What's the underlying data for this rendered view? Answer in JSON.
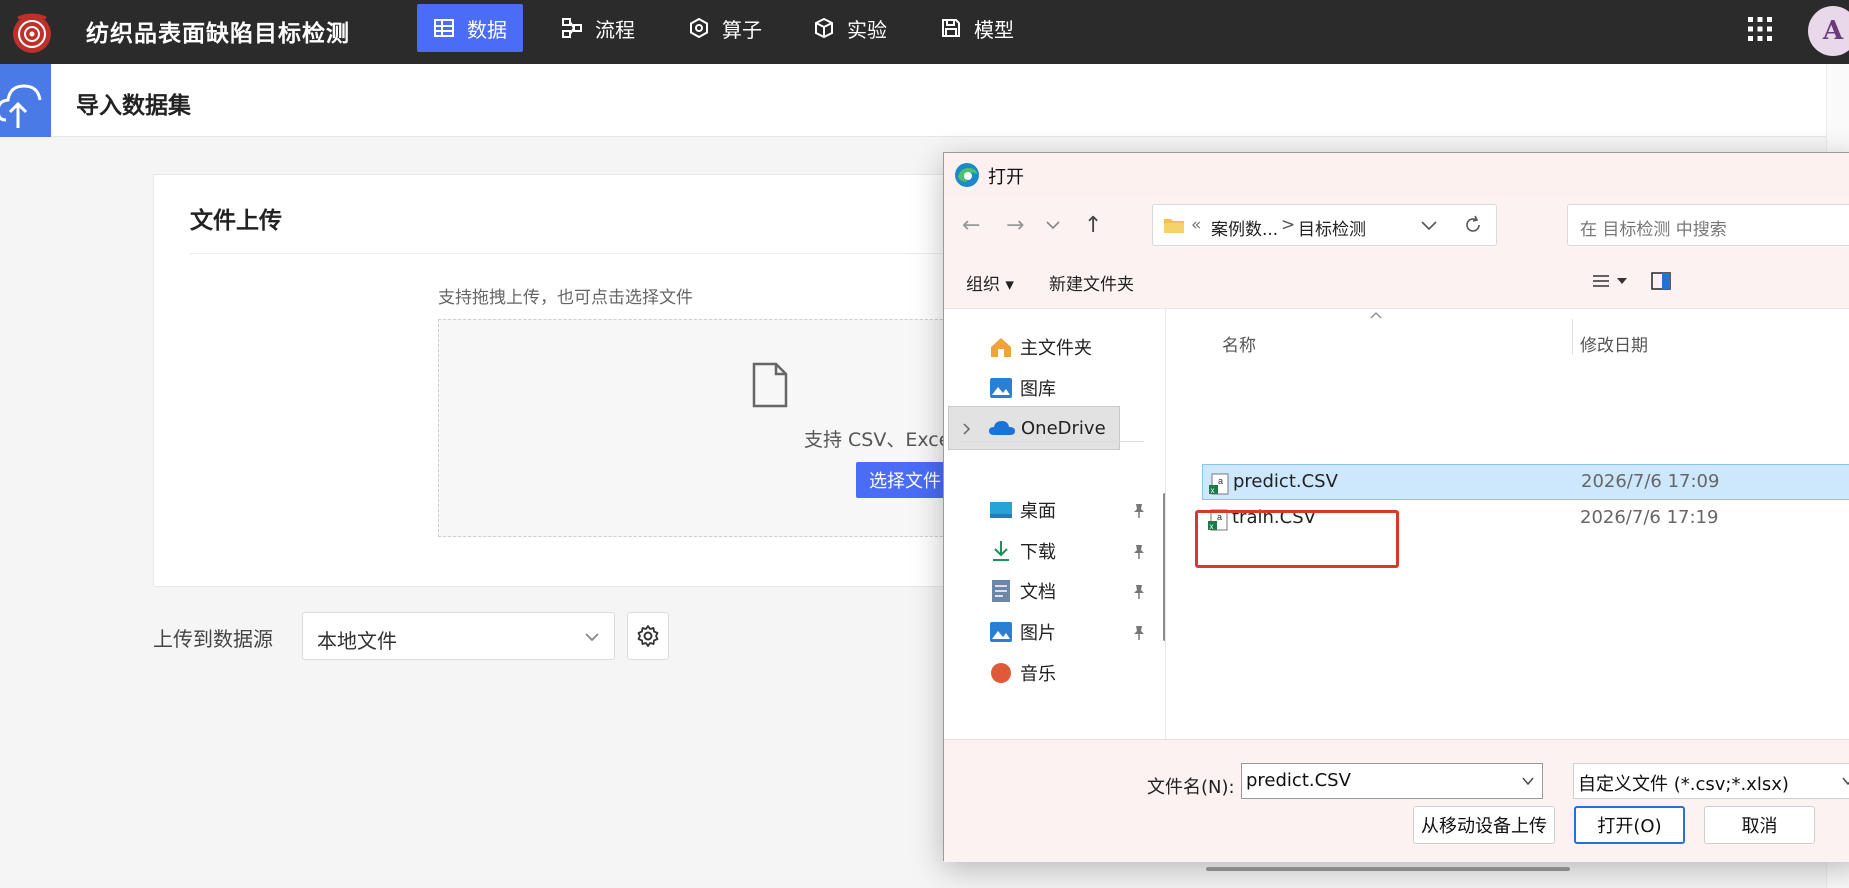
{
  "app": {
    "title": "纺织品表面缺陷目标检测"
  },
  "nav": [
    {
      "label": "数据",
      "icon": "table-icon",
      "active": true
    },
    {
      "label": "流程",
      "icon": "flow-icon",
      "active": false
    },
    {
      "label": "算子",
      "icon": "operator-icon",
      "active": false
    },
    {
      "label": "实验",
      "icon": "cube-icon",
      "active": false
    },
    {
      "label": "模型",
      "icon": "save-icon",
      "active": false
    }
  ],
  "user": {
    "avatar_letter": "A"
  },
  "page": {
    "title": "导入数据集"
  },
  "upload": {
    "card_title": "文件上传",
    "hint": "支持拖拽上传，也可点击选择文件",
    "support_text": "支持 CSV、Exce",
    "select_button": "选择文件",
    "datasource_label": "上传到数据源",
    "datasource_value": "本地文件"
  },
  "dialog": {
    "title": "打开",
    "breadcrumb": {
      "prefix": "«",
      "parent": "案例数...",
      "separator": ">",
      "current": "目标检测"
    },
    "search_placeholder": "在 目标检测 中搜索",
    "toolbar": {
      "organize": "组织",
      "new_folder": "新建文件夹"
    },
    "nav_items": [
      {
        "label": "主文件夹",
        "icon": "home-icon"
      },
      {
        "label": "图库",
        "icon": "gallery-icon"
      },
      {
        "label": "OneDrive",
        "icon": "onedrive-icon",
        "selected": true
      },
      {
        "label": "桌面",
        "icon": "desktop-icon",
        "pinned": true
      },
      {
        "label": "下载",
        "icon": "download-icon",
        "pinned": true
      },
      {
        "label": "文档",
        "icon": "document-icon",
        "pinned": true
      },
      {
        "label": "图片",
        "icon": "pictures-icon",
        "pinned": true
      },
      {
        "label": "音乐",
        "icon": "music-icon",
        "pinned": true
      }
    ],
    "columns": {
      "name": "名称",
      "modified": "修改日期"
    },
    "files": [
      {
        "name": "predict.CSV",
        "modified": "2026/7/6 17:09",
        "selected": true
      },
      {
        "name": "train.CSV",
        "modified": "2026/7/6 17:19",
        "selected": false
      }
    ],
    "filename_label": "文件名(N):",
    "filename_value": "predict.CSV",
    "filetype_value": "自定义文件 (*.csv;*.xlsx)",
    "buttons": {
      "mobile_upload": "从移动设备上传",
      "open": "打开(O)",
      "cancel": "取消"
    }
  },
  "colors": {
    "accent": "#4a6cf7",
    "topbar": "#2b2b2b",
    "highlight": "#d53a2a",
    "selection": "#cde8fc"
  }
}
